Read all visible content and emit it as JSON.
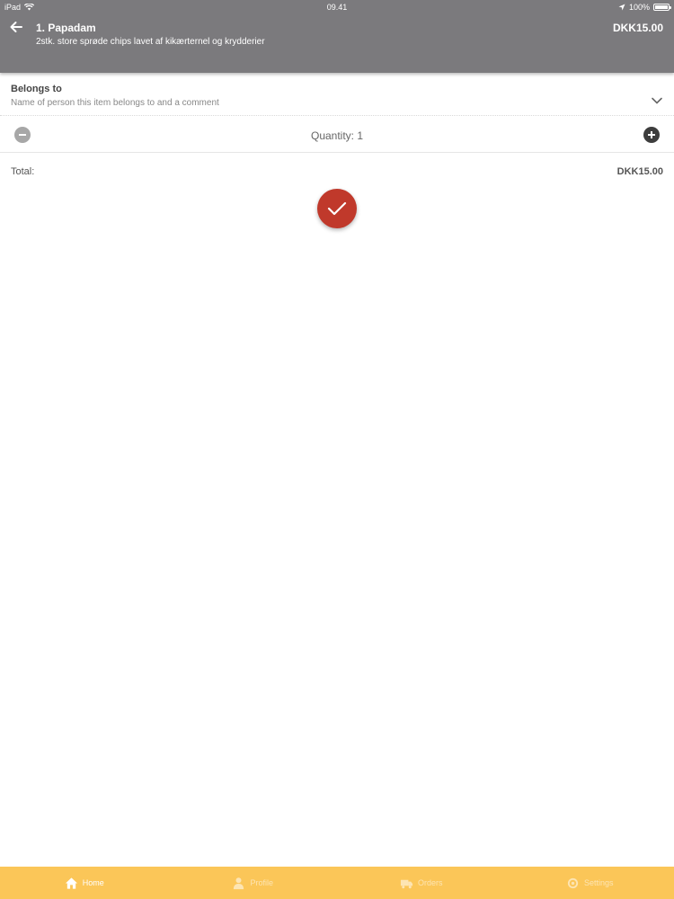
{
  "status_bar": {
    "device": "iPad",
    "time": "09.41",
    "battery": "100%"
  },
  "header": {
    "title": "1. Papadam",
    "description": "2stk. store sprøde chips lavet af kikærternel og krydderier",
    "price": "DKK15.00"
  },
  "belongs_to": {
    "title": "Belongs to",
    "hint": "Name of person this item belongs to and a comment"
  },
  "quantity": {
    "label": "Quantity: 1"
  },
  "total": {
    "label": "Total:",
    "value": "DKK15.00"
  },
  "tabbar": {
    "tabs": [
      {
        "label": "Home",
        "icon": "home-icon",
        "active": true
      },
      {
        "label": "Profile",
        "icon": "person-icon",
        "active": false
      },
      {
        "label": "Orders",
        "icon": "delivery-icon",
        "active": false
      },
      {
        "label": "Settings",
        "icon": "settings-icon",
        "active": false
      }
    ]
  },
  "colors": {
    "header": "#7b7a7d",
    "tabbar": "#fbc658",
    "confirm": "#c0392b"
  }
}
